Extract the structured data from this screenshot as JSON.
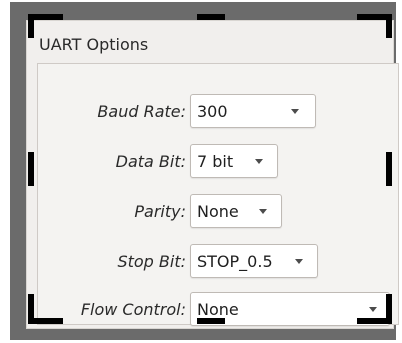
{
  "panel": {
    "title": "UART Options"
  },
  "fields": {
    "baud_rate": {
      "label": "Baud Rate:",
      "value": "300"
    },
    "data_bit": {
      "label": "Data Bit:",
      "value": "7 bit"
    },
    "parity": {
      "label": "Parity:",
      "value": "None"
    },
    "stop_bit": {
      "label": "Stop Bit:",
      "value": "STOP_0.5"
    },
    "flow_control": {
      "label": "Flow Control:",
      "value": "None"
    }
  },
  "icons": {
    "dropdown": "chevron-down-icon"
  }
}
